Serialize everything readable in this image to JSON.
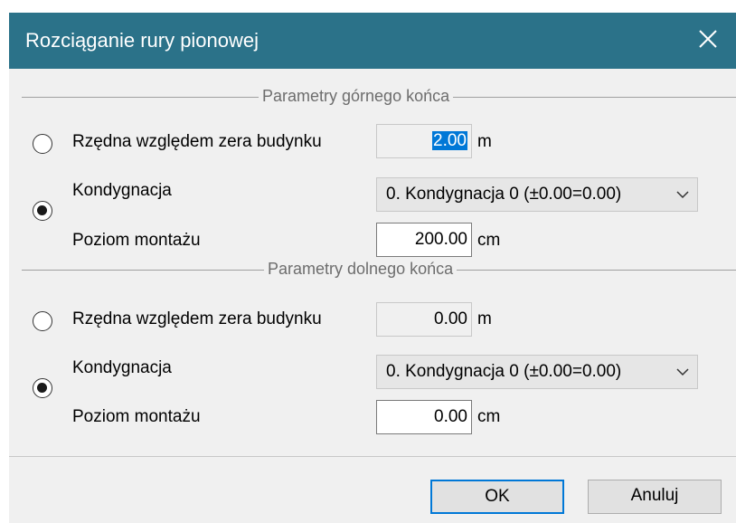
{
  "window": {
    "title": "Rozciąganie rury pionowej",
    "close_icon": "close-icon"
  },
  "top_section": {
    "title": "Parametry górnego końca",
    "elevation_label": "Rzędna względem zera budynku",
    "elevation_value": "2.00",
    "elevation_unit": "m",
    "elevation_selected": false,
    "storey_label": "Kondygnacja",
    "storey_value": "0. Kondygnacja 0 (±0.00=0.00)",
    "storey_selected": true,
    "mount_label": "Poziom montażu",
    "mount_value": "200.00",
    "mount_unit": "cm"
  },
  "bottom_section": {
    "title": "Parametry dolnego końca",
    "elevation_label": "Rzędna względem zera budynku",
    "elevation_value": "0.00",
    "elevation_unit": "m",
    "elevation_selected": false,
    "storey_label": "Kondygnacja",
    "storey_value": "0. Kondygnacja 0 (±0.00=0.00)",
    "storey_selected": true,
    "mount_label": "Poziom montażu",
    "mount_value": "0.00",
    "mount_unit": "cm"
  },
  "buttons": {
    "ok": "OK",
    "cancel": "Anuluj"
  }
}
